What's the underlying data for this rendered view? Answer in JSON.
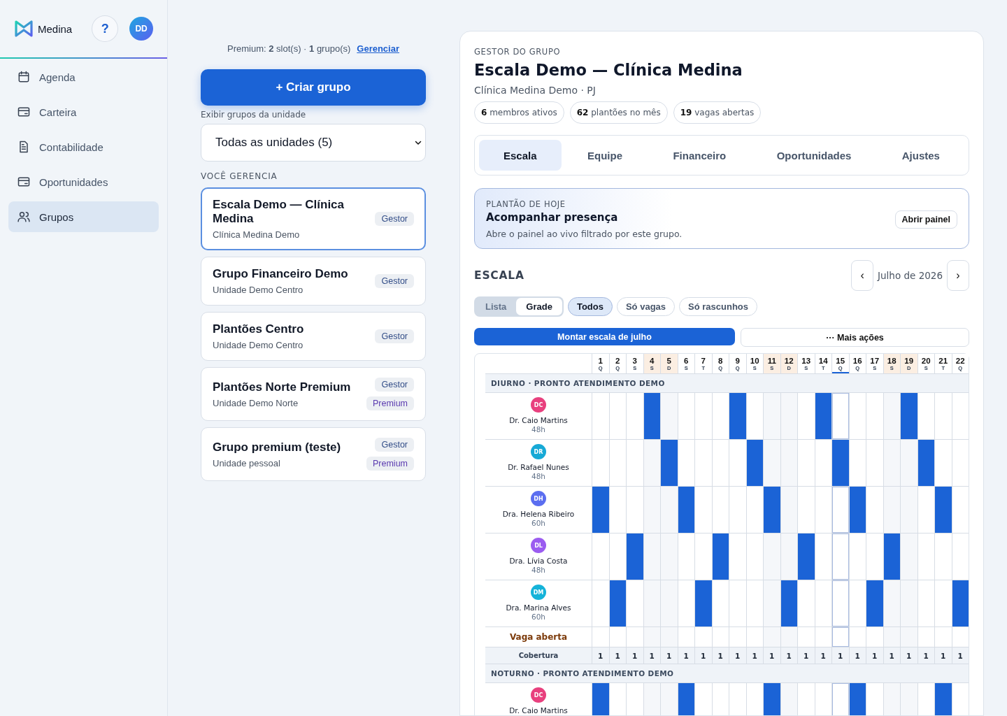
{
  "sidebar": {
    "brand": "Medina",
    "help": "?",
    "avatar": "DD",
    "items": [
      {
        "label": "Agenda",
        "selected": false
      },
      {
        "label": "Carteira",
        "selected": false
      },
      {
        "label": "Contabilidade",
        "selected": false
      },
      {
        "label": "Oportunidades",
        "selected": false
      },
      {
        "label": "Grupos",
        "selected": true
      }
    ]
  },
  "groups_panel": {
    "premium_summary": "Premium: **2** slot(s) · **1** grupo(s)",
    "manage_link": "Gerenciar",
    "create_button": "+ Criar grupo",
    "unit_filter": {
      "label": "Exibir grupos da unidade",
      "value": "Todas as unidades (5)"
    },
    "section_title": "VOCÊ GERENCIA",
    "groups": [
      {
        "name": "Escala Demo — Clínica Medina",
        "unit": "Clínica Medina Demo",
        "selected": true,
        "badges": [
          {
            "label": "Gestor",
            "kind": "role"
          }
        ]
      },
      {
        "name": "Grupo Financeiro Demo",
        "unit": "Unidade Demo Centro",
        "selected": false,
        "badges": [
          {
            "label": "Gestor",
            "kind": "role"
          }
        ]
      },
      {
        "name": "Plantões Centro",
        "unit": "Unidade Demo Centro",
        "selected": false,
        "badges": [
          {
            "label": "Gestor",
            "kind": "role"
          }
        ]
      },
      {
        "name": "Plantões Norte Premium",
        "unit": "Unidade Demo Norte",
        "selected": false,
        "badges": [
          {
            "label": "Gestor",
            "kind": "role"
          },
          {
            "label": "Premium",
            "kind": "plan"
          }
        ]
      },
      {
        "name": "Grupo premium (teste)",
        "unit": "Unidade pessoal",
        "selected": false,
        "badges": [
          {
            "label": "Gestor",
            "kind": "role"
          },
          {
            "label": "Premium",
            "kind": "plan"
          }
        ]
      }
    ]
  },
  "detail": {
    "eyebrow": "GESTOR DO GRUPO",
    "title": "Escala Demo — Clínica Medina",
    "subtitle": "Clínica Medina Demo · PJ",
    "stats": [
      "**6** membros ativos",
      "**62** plantões no mês",
      "**19** vagas abertas"
    ],
    "tabs": [
      {
        "label": "Escala",
        "selected": true
      },
      {
        "label": "Equipe",
        "selected": false
      },
      {
        "label": "Financeiro",
        "selected": false
      },
      {
        "label": "Oportunidades",
        "selected": false
      },
      {
        "label": "Ajustes",
        "selected": false
      }
    ],
    "today_card": {
      "eyebrow": "PLANTÃO DE HOJE",
      "title": "Acompanhar presença",
      "text": "Abre o painel ao vivo filtrado por este grupo.",
      "button": "Abrir painel"
    },
    "schedule": {
      "title": "ESCALA",
      "prev": "‹",
      "month": "Julho de 2026",
      "next": "›",
      "view_toggle": [
        {
          "label": "Lista",
          "selected": false
        },
        {
          "label": "Grade",
          "selected": true
        }
      ],
      "filters": [
        {
          "label": "Todos",
          "selected": true
        },
        {
          "label": "Só vagas",
          "selected": false
        },
        {
          "label": "Só rascunhos",
          "selected": false
        }
      ],
      "primary_action": "Montar escala de julho",
      "more_actions": "··· Mais ações",
      "days": [
        {
          "day": "1",
          "weekday": "Q",
          "weekend": false,
          "today": false
        },
        {
          "day": "2",
          "weekday": "Q",
          "weekend": false,
          "today": false
        },
        {
          "day": "3",
          "weekday": "S",
          "weekend": false,
          "today": false
        },
        {
          "day": "4",
          "weekday": "S",
          "weekend": true,
          "today": false
        },
        {
          "day": "5",
          "weekday": "D",
          "weekend": true,
          "today": false
        },
        {
          "day": "6",
          "weekday": "S",
          "weekend": false,
          "today": false
        },
        {
          "day": "7",
          "weekday": "T",
          "weekend": false,
          "today": false
        },
        {
          "day": "8",
          "weekday": "Q",
          "weekend": false,
          "today": false
        },
        {
          "day": "9",
          "weekday": "Q",
          "weekend": false,
          "today": false
        },
        {
          "day": "10",
          "weekday": "S",
          "weekend": false,
          "today": false
        },
        {
          "day": "11",
          "weekday": "S",
          "weekend": true,
          "today": false
        },
        {
          "day": "12",
          "weekday": "D",
          "weekend": true,
          "today": false
        },
        {
          "day": "13",
          "weekday": "S",
          "weekend": false,
          "today": false
        },
        {
          "day": "14",
          "weekday": "T",
          "weekend": false,
          "today": false
        },
        {
          "day": "15",
          "weekday": "Q",
          "weekend": false,
          "today": true
        },
        {
          "day": "16",
          "weekday": "Q",
          "weekend": false,
          "today": false
        },
        {
          "day": "17",
          "weekday": "S",
          "weekend": false,
          "today": false
        },
        {
          "day": "18",
          "weekday": "S",
          "weekend": true,
          "today": false
        },
        {
          "day": "19",
          "weekday": "D",
          "weekend": true,
          "today": false
        },
        {
          "day": "20",
          "weekday": "S",
          "weekend": false,
          "today": false
        },
        {
          "day": "21",
          "weekday": "T",
          "weekend": false,
          "today": false
        },
        {
          "day": "22",
          "weekday": "Q",
          "weekend": false,
          "today": false
        }
      ],
      "shifts": [
        {
          "title": "DIURNO · PRONTO ATENDIMENTO DEMO",
          "members": [
            {
              "initials": "DC",
              "name": "Dr. Caio Martins",
              "hours": "48h",
              "color": "#e8407e",
              "filled": [
                false,
                false,
                false,
                true,
                false,
                false,
                false,
                false,
                true,
                false,
                false,
                false,
                false,
                true,
                false,
                false,
                false,
                false,
                true,
                false,
                false,
                false
              ]
            },
            {
              "initials": "DR",
              "name": "Dr. Rafael Nunes",
              "hours": "48h",
              "color": "#17a9d6",
              "filled": [
                false,
                false,
                false,
                false,
                true,
                false,
                false,
                false,
                false,
                true,
                false,
                false,
                false,
                false,
                true,
                false,
                false,
                false,
                false,
                true,
                false,
                false
              ]
            },
            {
              "initials": "DH",
              "name": "Dra. Helena Ribeiro",
              "hours": "60h",
              "color": "#5b6ef0",
              "filled": [
                true,
                false,
                false,
                false,
                false,
                true,
                false,
                false,
                false,
                false,
                true,
                false,
                false,
                false,
                false,
                true,
                false,
                false,
                false,
                false,
                true,
                false
              ]
            },
            {
              "initials": "DL",
              "name": "Dra. Lívia Costa",
              "hours": "48h",
              "color": "#9b5cf0",
              "filled": [
                false,
                false,
                true,
                false,
                false,
                false,
                false,
                true,
                false,
                false,
                false,
                false,
                true,
                false,
                false,
                false,
                false,
                true,
                false,
                false,
                false,
                false
              ]
            },
            {
              "initials": "DM",
              "name": "Dra. Marina Alves",
              "hours": "60h",
              "color": "#15b3d9",
              "filled": [
                false,
                true,
                false,
                false,
                false,
                false,
                true,
                false,
                false,
                false,
                false,
                true,
                false,
                false,
                false,
                false,
                true,
                false,
                false,
                false,
                false,
                true
              ]
            }
          ],
          "open_slot": {
            "label": "Vaga aberta",
            "filled": [
              false,
              false,
              false,
              false,
              false,
              false,
              false,
              false,
              false,
              false,
              false,
              false,
              false,
              false,
              false,
              false,
              false,
              false,
              false,
              false,
              false,
              false
            ]
          },
          "coverage": {
            "label": "Cobertura",
            "values": [
              "1",
              "1",
              "1",
              "1",
              "1",
              "1",
              "1",
              "1",
              "1",
              "1",
              "1",
              "1",
              "1",
              "1",
              "1",
              "1",
              "1",
              "1",
              "1",
              "1",
              "1",
              "1"
            ]
          }
        },
        {
          "title": "NOTURNO · PRONTO ATENDIMENTO DEMO",
          "members": [
            {
              "initials": "DC",
              "name": "Dr. Caio Martins",
              "color": "#e8407e",
              "filled": [
                true,
                false,
                false,
                false,
                false,
                true,
                false,
                false,
                false,
                false,
                true,
                false,
                false,
                false,
                false,
                true,
                false,
                false,
                false,
                false,
                true,
                false
              ]
            }
          ]
        }
      ]
    }
  }
}
